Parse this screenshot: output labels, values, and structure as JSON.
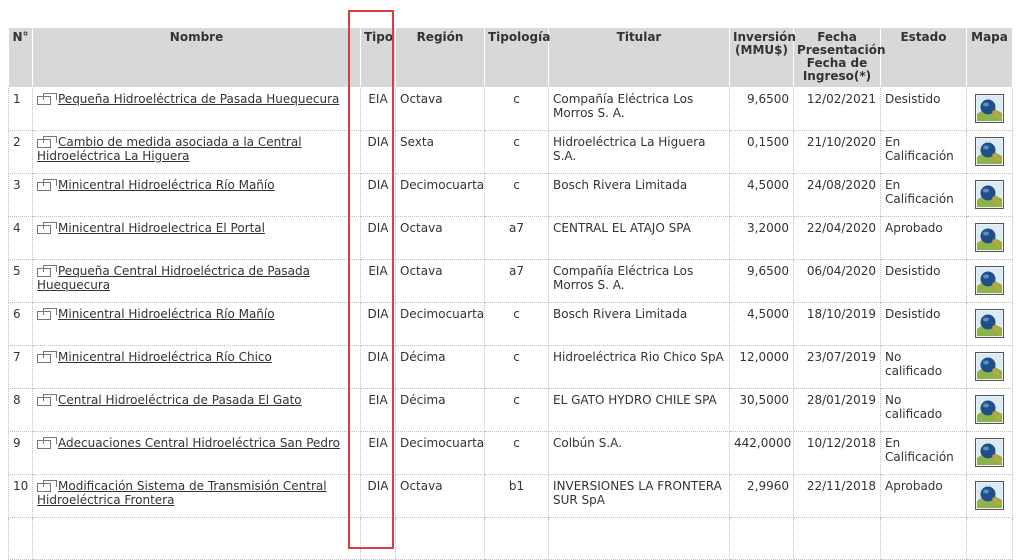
{
  "headers": {
    "num": "N°",
    "nombre": "Nombre",
    "tipo": "Tipo",
    "region": "Región",
    "tipologia": "Tipología",
    "titular": "Titular",
    "inversion": "Inversión (MMU$)",
    "fecha": "Fecha Presentación Fecha de Ingreso(*)",
    "estado": "Estado",
    "mapa": "Mapa"
  },
  "rows": [
    {
      "num": "1",
      "nombre": "Pequeña Hidroeléctrica de Pasada Huequecura",
      "tipo": "EIA",
      "region": "Octava",
      "tipologia": "c",
      "titular": "Compañía Eléctrica Los Morros S. A.",
      "inversion": "9,6500",
      "fecha": "12/02/2021",
      "estado": "Desistido"
    },
    {
      "num": "2",
      "nombre": "Cambio de medida asociada a la Central Hidroeléctrica La Higuera",
      "tipo": "DIA",
      "region": "Sexta",
      "tipologia": "c",
      "titular": "Hidroeléctrica La Higuera S.A.",
      "inversion": "0,1500",
      "fecha": "21/10/2020",
      "estado": "En Calificación"
    },
    {
      "num": "3",
      "nombre": "Minicentral Hidroeléctrica Río Mañío",
      "tipo": "DIA",
      "region": "Decimocuarta",
      "tipologia": "c",
      "titular": "Bosch Rivera Limitada",
      "inversion": "4,5000",
      "fecha": "24/08/2020",
      "estado": "En Calificación"
    },
    {
      "num": "4",
      "nombre": "Minicentral Hidroelectrica El Portal",
      "tipo": "DIA",
      "region": "Octava",
      "tipologia": "a7",
      "titular": "CENTRAL EL ATAJO SPA",
      "inversion": "3,2000",
      "fecha": "22/04/2020",
      "estado": "Aprobado"
    },
    {
      "num": "5",
      "nombre": "Pequeña Central Hidroeléctrica de Pasada Huequecura",
      "tipo": "EIA",
      "region": "Octava",
      "tipologia": "a7",
      "titular": "Compañía Eléctrica Los Morros S. A.",
      "inversion": "9,6500",
      "fecha": "06/04/2020",
      "estado": "Desistido"
    },
    {
      "num": "6",
      "nombre": "Minicentral Hidroeléctrica Río Mañío",
      "tipo": "DIA",
      "region": "Decimocuarta",
      "tipologia": "c",
      "titular": "Bosch Rivera Limitada",
      "inversion": "4,5000",
      "fecha": "18/10/2019",
      "estado": "Desistido"
    },
    {
      "num": "7",
      "nombre": "Minicentral Hidroeléctrica Río Chico",
      "tipo": "DIA",
      "region": "Décima",
      "tipologia": "c",
      "titular": "Hidroeléctrica Rio Chico SpA",
      "inversion": "12,0000",
      "fecha": "23/07/2019",
      "estado": "No calificado"
    },
    {
      "num": "8",
      "nombre": "Central Hidroeléctrica de Pasada El Gato",
      "tipo": "EIA",
      "region": "Décima",
      "tipologia": "c",
      "titular": "EL GATO HYDRO CHILE SPA",
      "inversion": "30,5000",
      "fecha": "28/01/2019",
      "estado": "No calificado"
    },
    {
      "num": "9",
      "nombre": "Adecuaciones Central Hidroeléctrica San Pedro",
      "tipo": "EIA",
      "region": "Decimocuarta",
      "tipologia": "c",
      "titular": "Colbún S.A.",
      "inversion": "442,0000",
      "fecha": "10/12/2018",
      "estado": "En Calificación"
    },
    {
      "num": "10",
      "nombre": "Modificación Sistema de Transmisión Central Hidroeléctrica Frontera",
      "tipo": "DIA",
      "region": "Octava",
      "tipologia": "b1",
      "titular": "INVERSIONES LA FRONTERA SUR SpA",
      "inversion": "2,9960",
      "fecha": "22/11/2018",
      "estado": "Aprobado"
    }
  ],
  "colors": {
    "header_bg": "#d8d8d8",
    "highlight": "#e03a3a"
  },
  "icons": {
    "link": "window-icon",
    "map": "map-globe-icon"
  }
}
